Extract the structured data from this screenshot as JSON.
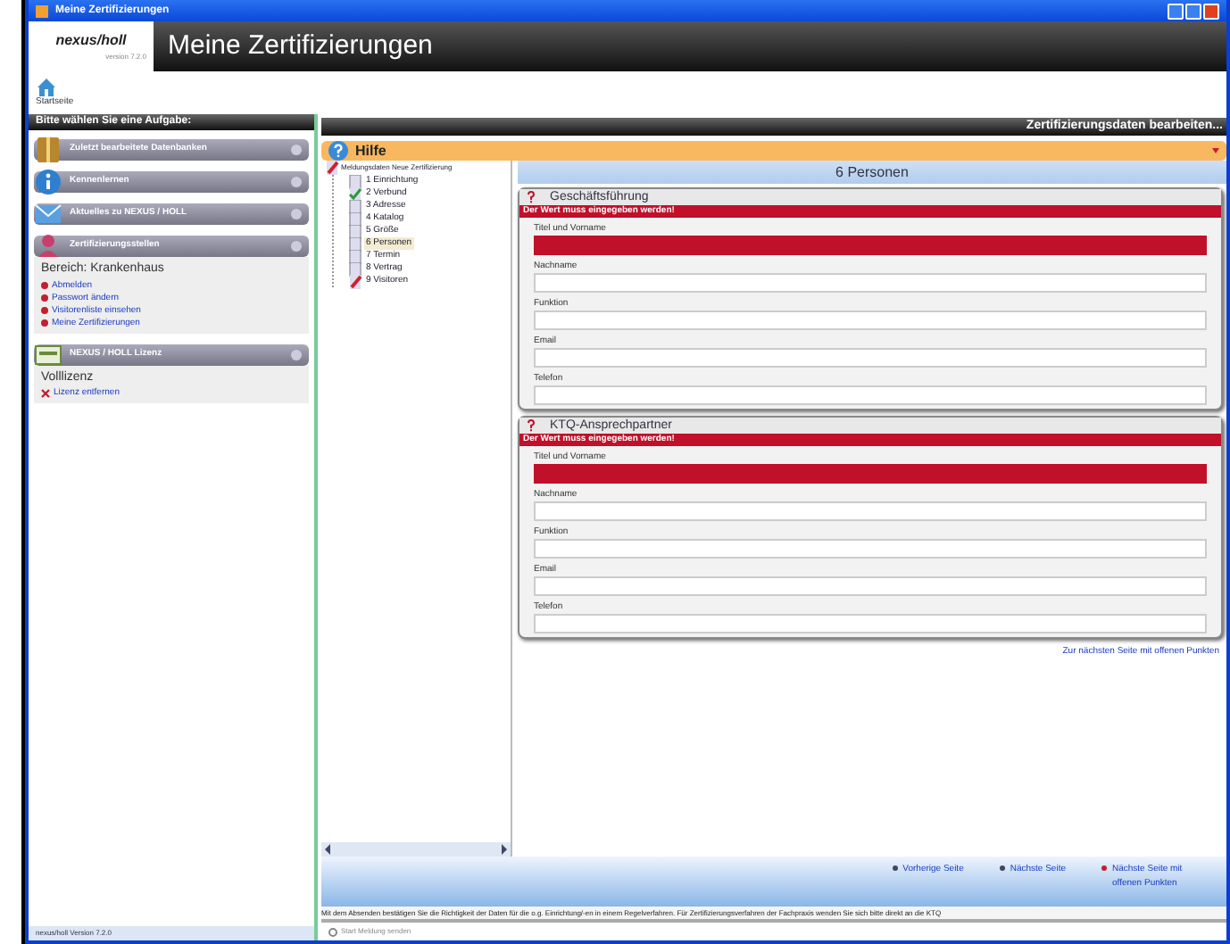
{
  "window": {
    "title": "Meine Zertifizierungen",
    "logo": "nexus/holl",
    "logo_version": "version 7.2.0",
    "header_title": "Meine Zertifizierungen"
  },
  "toolbar": {
    "home_label": "Startseite"
  },
  "sidebar": {
    "title": "Bitte wählen Sie eine Aufgabe:",
    "panels": [
      {
        "title": "Zuletzt bearbeitete Datenbanken",
        "kind": "book"
      },
      {
        "title": "Kennenlernen",
        "kind": "info"
      },
      {
        "title": "Aktuelles zu NEXUS / HOLL",
        "kind": "mail"
      },
      {
        "title": "Zertifizierungsstellen",
        "kind": "person",
        "lines": [
          "Bereich: Krankenhaus"
        ],
        "links": [
          {
            "label": "Abmelden",
            "kind": "dot"
          },
          {
            "label": "Passwort ändern",
            "kind": "dot"
          },
          {
            "label": "Visitorenliste einsehen",
            "kind": "dot"
          },
          {
            "label": "Meine Zertifizierungen",
            "kind": "dot"
          }
        ]
      },
      {
        "title": "NEXUS / HOLL Lizenz",
        "kind": "license",
        "lines": [
          "Volllizenz"
        ],
        "links": [
          {
            "label": "Lizenz entfernen",
            "kind": "cross"
          }
        ]
      }
    ],
    "version": "nexus/holl Version 7.2.0"
  },
  "main": {
    "title": "Zertifizierungsdaten bearbeiten...",
    "help": "Hilfe",
    "tree": {
      "label": "Meldungsdaten Neue Zertifizierung",
      "children": [
        {
          "label": "1 Einrichtung",
          "kind": "doc",
          "selected": false
        },
        {
          "label": "2 Verbund",
          "kind": "done",
          "selected": false
        },
        {
          "label": "3 Adresse",
          "kind": "doc",
          "selected": false
        },
        {
          "label": "4 Katalog",
          "kind": "doc",
          "selected": false
        },
        {
          "label": "5 Größe",
          "kind": "doc",
          "selected": false
        },
        {
          "label": "6 Personen",
          "kind": "doc",
          "selected": true
        },
        {
          "label": "7 Termin",
          "kind": "doc",
          "selected": false
        },
        {
          "label": "8 Vertrag",
          "kind": "doc",
          "selected": false
        },
        {
          "label": "9 Visitoren",
          "kind": "warning",
          "selected": false
        }
      ]
    },
    "page_title": "6 Personen",
    "sections": [
      {
        "title": "Geschäftsführung",
        "error": "Der Wert muss eingegeben werden!",
        "fields": [
          {
            "label": "Titel und Vorname",
            "error": true
          },
          {
            "label": "Nachname",
            "error": false
          },
          {
            "label": "Funktion",
            "error": false
          },
          {
            "label": "Email",
            "error": false
          },
          {
            "label": "Telefon",
            "error": false
          }
        ]
      },
      {
        "title": "KTQ-Ansprechpartner",
        "error": "Der Wert muss eingegeben werden!",
        "fields": [
          {
            "label": "Titel und Vorname",
            "error": true
          },
          {
            "label": "Nachname",
            "error": false
          },
          {
            "label": "Funktion",
            "error": false
          },
          {
            "label": "Email",
            "error": false
          },
          {
            "label": "Telefon",
            "error": false
          }
        ]
      }
    ],
    "next_open_link": "Zur nächsten Seite mit offenen Punkten",
    "nav": [
      "Vorherige Seite",
      "Nächste Seite",
      "Nächste Seite mit offenen Punkten"
    ],
    "footer_text": "Mit dem Absenden bestätigen Sie die Richtigkeit der Daten für die o.g. Einrichtung/-en in einem Regelverfahren. Für Zertifizierungsverfahren der Fachpraxis wenden Sie sich bitte direkt an die KTQ",
    "send": "Start Meldung senden"
  }
}
